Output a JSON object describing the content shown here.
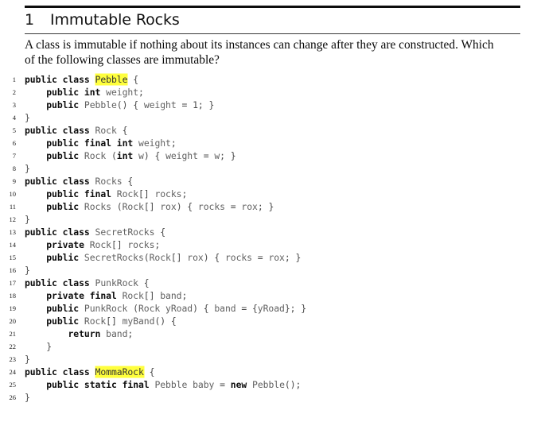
{
  "document": {
    "heading": {
      "number": "1",
      "title": "Immutable Rocks"
    },
    "intro": {
      "line1": "A class is immutable if nothing about its instances can change after they are constructed.  Which",
      "line2": "of the following classes are immutable?"
    },
    "highlight_color": "#ffff3d",
    "keyword_color": "#0b0b0b",
    "identifier_color": "#606060",
    "code": {
      "language": "Java",
      "lines": [
        {
          "num": "1",
          "text": "public class Pebble {"
        },
        {
          "num": "2",
          "text": "    public int weight;"
        },
        {
          "num": "3",
          "text": "    public Pebble() { weight = 1; }"
        },
        {
          "num": "4",
          "text": "}"
        },
        {
          "num": "5",
          "text": "public class Rock {"
        },
        {
          "num": "6",
          "text": "    public final int weight;"
        },
        {
          "num": "7",
          "text": "    public Rock (int w) { weight = w; }"
        },
        {
          "num": "8",
          "text": "}"
        },
        {
          "num": "9",
          "text": "public class Rocks {"
        },
        {
          "num": "10",
          "text": "    public final Rock[] rocks;"
        },
        {
          "num": "11",
          "text": "    public Rocks (Rock[] rox) { rocks = rox; }"
        },
        {
          "num": "12",
          "text": "}"
        },
        {
          "num": "13",
          "text": "public class SecretRocks {"
        },
        {
          "num": "14",
          "text": "    private Rock[] rocks;"
        },
        {
          "num": "15",
          "text": "    public SecretRocks(Rock[] rox) { rocks = rox; }"
        },
        {
          "num": "16",
          "text": "}"
        },
        {
          "num": "17",
          "text": "public class PunkRock {"
        },
        {
          "num": "18",
          "text": "    private final Rock[] band;"
        },
        {
          "num": "19",
          "text": "    public PunkRock (Rock yRoad) { band = {yRoad}; }"
        },
        {
          "num": "20",
          "text": "    public Rock[] myBand() {"
        },
        {
          "num": "21",
          "text": "        return band;"
        },
        {
          "num": "22",
          "text": "    }"
        },
        {
          "num": "23",
          "text": "}"
        },
        {
          "num": "24",
          "text": "public class MommaRock {"
        },
        {
          "num": "25",
          "text": "    public static final Pebble baby = new Pebble();"
        },
        {
          "num": "26",
          "text": "}"
        }
      ],
      "highlighted_tokens": [
        "Pebble",
        "MommaRock"
      ],
      "highlighted_occurrences": [
        {
          "line": "1",
          "token": "Pebble"
        },
        {
          "line": "24",
          "token": "MommaRock"
        }
      ],
      "keywords": [
        "public",
        "private",
        "class",
        "int",
        "final",
        "static",
        "new",
        "return"
      ]
    }
  }
}
